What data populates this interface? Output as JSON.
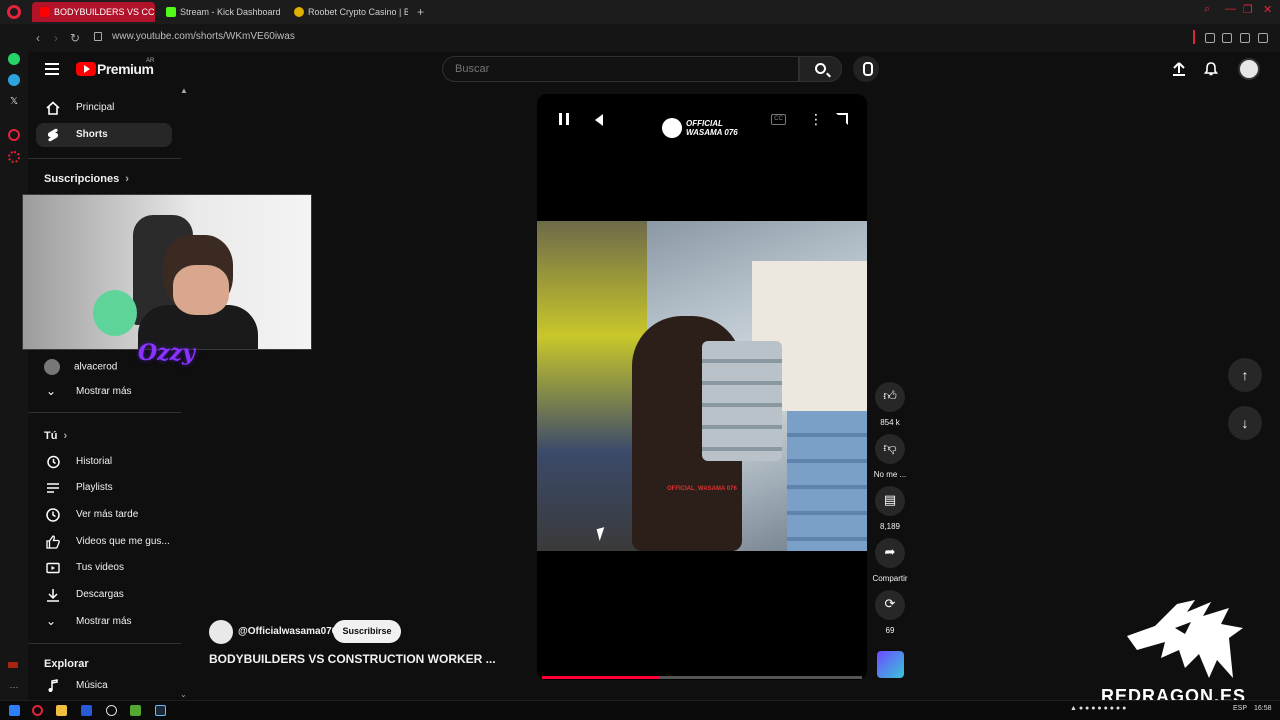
{
  "browser": {
    "tabs": [
      {
        "label": "BODYBUILDERS VS CC",
        "active": true,
        "fav_color": "#ff0000"
      },
      {
        "label": "Stream - Kick Dashboard",
        "active": false,
        "fav_color": "#53fc18"
      },
      {
        "label": "Roobet Crypto Casino | Be",
        "active": false,
        "fav_color": "#e0b000"
      }
    ],
    "url": "www.youtube.com/shorts/WKmVE60iwas"
  },
  "header": {
    "brand": "Premium",
    "country": "AR",
    "search_placeholder": "Buscar"
  },
  "sidebar": {
    "items": [
      {
        "label": "Principal",
        "icon": "home-icon"
      },
      {
        "label": "Shorts",
        "icon": "shorts-icon",
        "active": true
      }
    ],
    "subscriptions_title": "Suscripciones",
    "subscriptions": [
      {
        "label": "alvacerod"
      }
    ],
    "show_more_1": "Mostrar más",
    "you_title": "Tú",
    "you_items": [
      {
        "label": "Historial",
        "icon": "history-icon"
      },
      {
        "label": "Playlists",
        "icon": "playlists-icon"
      },
      {
        "label": "Ver más tarde",
        "icon": "clock-icon"
      },
      {
        "label": "Videos que me gus...",
        "icon": "thumbs-up-icon"
      },
      {
        "label": "Tus videos",
        "icon": "your-videos-icon"
      },
      {
        "label": "Descargas",
        "icon": "download-icon"
      }
    ],
    "show_more_2": "Mostrar más",
    "explore_title": "Explorar",
    "explore_items": [
      {
        "label": "Música",
        "icon": "music-icon"
      }
    ]
  },
  "overlay": {
    "streamer_tag": "Ozzy"
  },
  "player": {
    "watermark_line1": "OFFICIAL",
    "watermark_line2": "WASAMA 076",
    "video_watermark": "OFFICIAL_WASAMA 076",
    "progress": 0.37
  },
  "actions": {
    "likes": "854 k",
    "dislike_label": "No me ...",
    "comments": "8,189",
    "share_label": "Compartir",
    "remix_count": "69"
  },
  "video": {
    "channel": "@Officialwasama076",
    "subscribe_label": "Suscribirse",
    "title": "BODYBUILDERS VS CONSTRUCTION WORKER ..."
  },
  "branding": {
    "redragon": "REDRAGON.ES"
  },
  "taskbar": {
    "lang": "ESP",
    "time": "16:58"
  },
  "colors": {
    "accent": "#ff0000",
    "progress": "#ff0033",
    "opera": "#e2243b"
  }
}
